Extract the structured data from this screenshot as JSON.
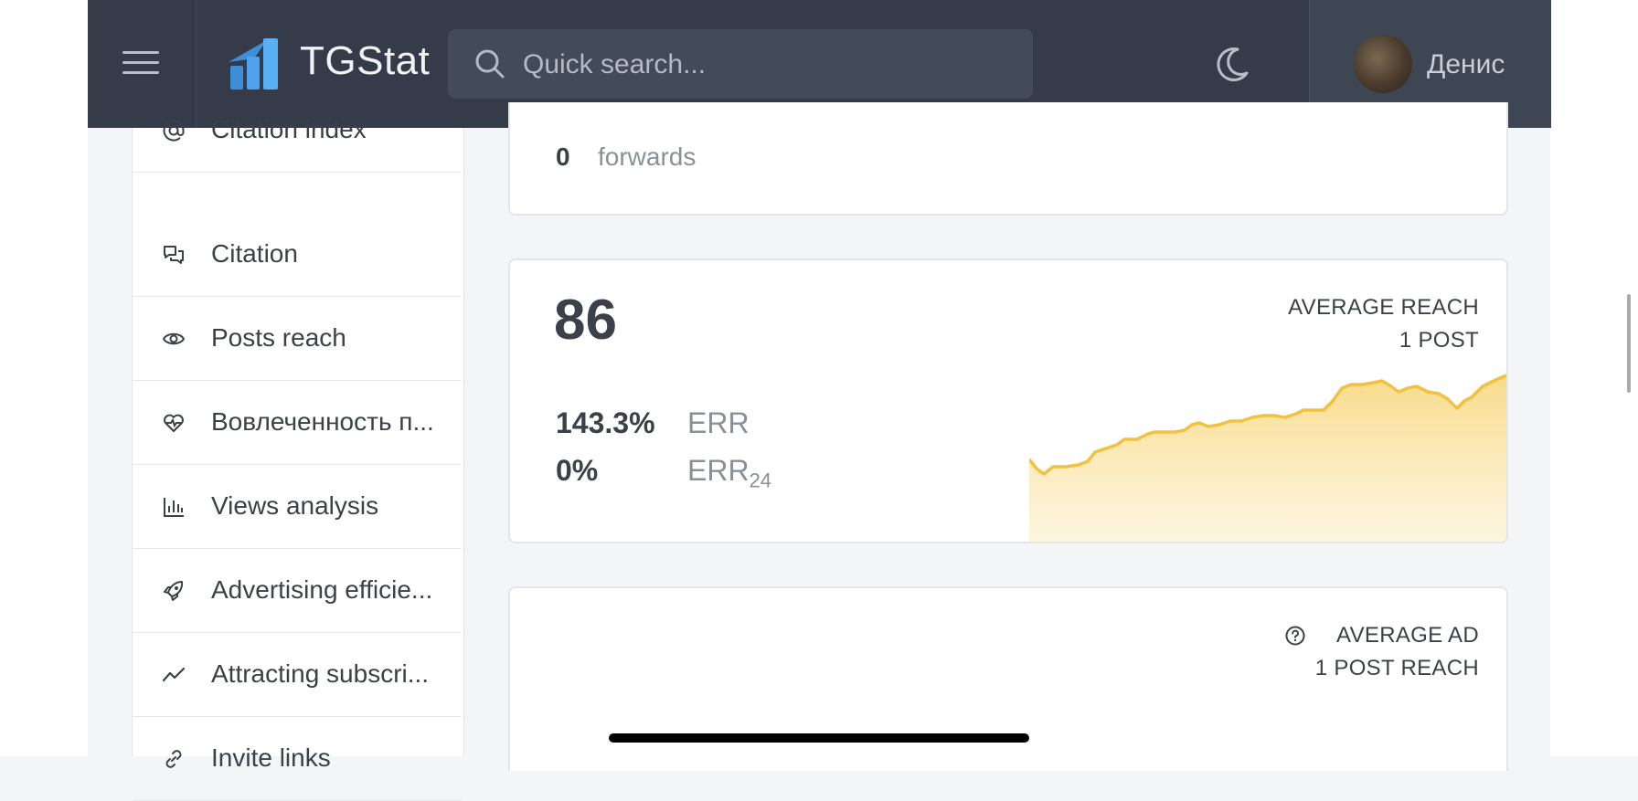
{
  "header": {
    "brand": "TGStat",
    "search_placeholder": "Quick search...",
    "user_name": "Денис"
  },
  "sidebar": {
    "items": [
      {
        "label": "Citation index",
        "icon": "at-icon"
      },
      {
        "label": "Citation",
        "icon": "chat-bubbles-icon"
      },
      {
        "label": "Posts reach",
        "icon": "eye-icon"
      },
      {
        "label": "Вовлеченность п...",
        "icon": "heart-pulse-icon"
      },
      {
        "label": "Views analysis",
        "icon": "bar-chart-icon"
      },
      {
        "label": "Advertising efficie...",
        "icon": "rocket-icon"
      },
      {
        "label": "Attracting subscri...",
        "icon": "trending-line-icon"
      },
      {
        "label": "Invite links",
        "icon": "link-icon"
      }
    ]
  },
  "forwards_card": {
    "value": "0",
    "label": "forwards"
  },
  "reach_card": {
    "value": "86",
    "title_line1": "AVERAGE REACH",
    "title_line2": "1 POST",
    "err_value": "143.3%",
    "err_label": "ERR",
    "err24_value": "0%",
    "err24_label": "ERR",
    "err24_sub": "24",
    "sparkline_color": "#f2c140"
  },
  "ad_card": {
    "title_line1": "AVERAGE AD",
    "title_line2": "1 POST REACH"
  }
}
